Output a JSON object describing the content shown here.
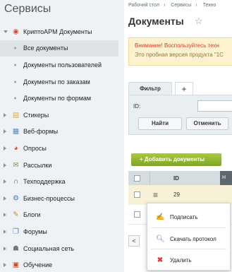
{
  "sidebar": {
    "title": "Сервисы",
    "top_item": "КриптоАРМ Документы",
    "sub_items": [
      "Все документы",
      "Документы пользователей",
      "Документы по заказам",
      "Документы по формам"
    ],
    "items": [
      "Стикеры",
      "Веб-формы",
      "Опросы",
      "Рассылки",
      "Техподдержка",
      "Бизнес-процессы",
      "Блоги",
      "Форумы",
      "Социальная сеть",
      "Обучение"
    ]
  },
  "breadcrumb": [
    "Рабочий стол",
    "Сервисы",
    "Техно"
  ],
  "page": {
    "title": "Документы"
  },
  "alert": {
    "warning": "Внимание! Воспользуйтесь техн",
    "note": "Это пробная версия продукта \"1С"
  },
  "filter": {
    "tab_label": "Фильтр",
    "add_tab": "+",
    "id_label": "ID:",
    "find_button": "Найти",
    "reset_button": "Отменить"
  },
  "add_button": "+ Добавить документы",
  "grid": {
    "col_id": "ID",
    "col_next": "Н",
    "rows": [
      {
        "id": "29"
      }
    ]
  },
  "pager": {
    "prev": "<"
  },
  "context_menu": [
    "Подписать",
    "Скачать протокол",
    "Удалить"
  ]
}
